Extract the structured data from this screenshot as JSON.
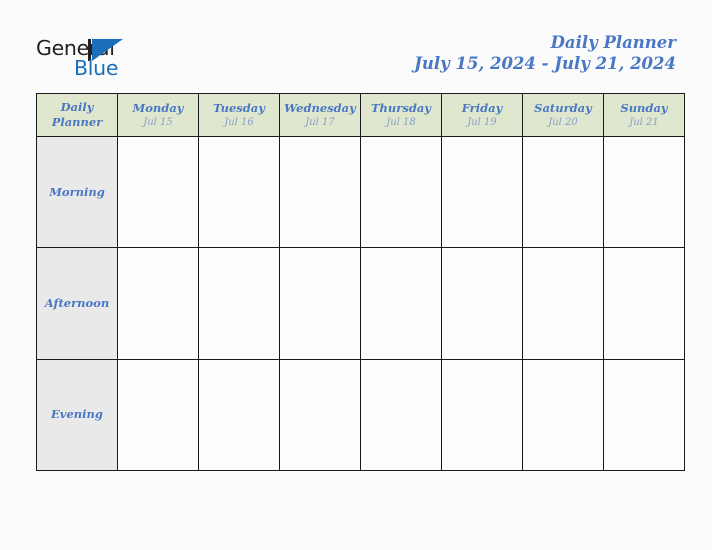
{
  "brand": {
    "name_dark": "General",
    "name_blue": "Blue",
    "mark": "triangle-logo-icon",
    "color_dark": "#231f20",
    "color_blue": "#1b6fba"
  },
  "header": {
    "title": "Daily Planner",
    "date_range": "July 15, 2024 - July 21, 2024",
    "title_color": "#4a77c4"
  },
  "table": {
    "corner": {
      "line1": "Daily",
      "line2": "Planner"
    },
    "header_bg": "#dfe8cf",
    "row_label_bg": "#e9e9e9",
    "border_color": "#1a1a1a",
    "day_color": "#4a77c4",
    "date_color": "#879ec9",
    "columns": [
      {
        "day": "Monday",
        "date": "Jul 15"
      },
      {
        "day": "Tuesday",
        "date": "Jul 16"
      },
      {
        "day": "Wednesday",
        "date": "Jul 17"
      },
      {
        "day": "Thursday",
        "date": "Jul 18"
      },
      {
        "day": "Friday",
        "date": "Jul 19"
      },
      {
        "day": "Saturday",
        "date": "Jul 20"
      },
      {
        "day": "Sunday",
        "date": "Jul 21"
      }
    ],
    "rows": [
      {
        "label": "Morning",
        "cells": [
          "",
          "",
          "",
          "",
          "",
          "",
          ""
        ]
      },
      {
        "label": "Afternoon",
        "cells": [
          "",
          "",
          "",
          "",
          "",
          "",
          ""
        ]
      },
      {
        "label": "Evening",
        "cells": [
          "",
          "",
          "",
          "",
          "",
          "",
          ""
        ]
      }
    ]
  }
}
